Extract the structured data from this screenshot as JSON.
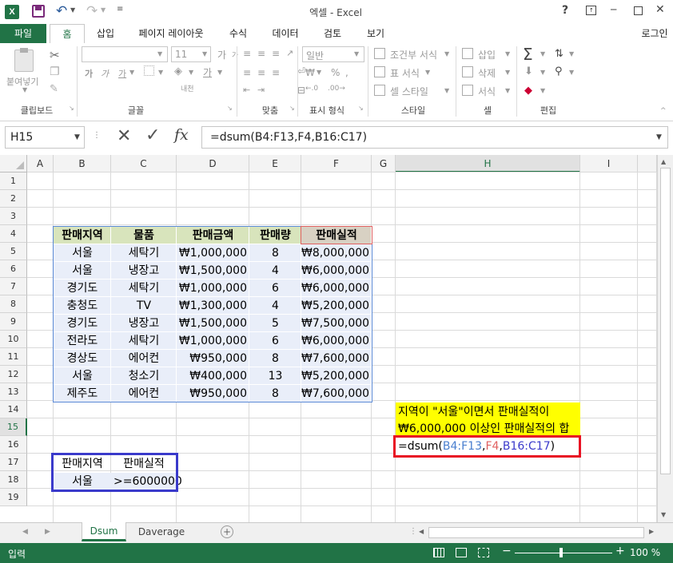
{
  "titlebar": {
    "title": "엑셀 - Excel",
    "help": "?",
    "minimize": "─",
    "close": "✕"
  },
  "menubar": {
    "file": "파일",
    "tabs": [
      "홈",
      "삽입",
      "페이지 레이아웃",
      "수식",
      "데이터",
      "검토",
      "보기"
    ],
    "signin": "로그인"
  },
  "ribbon": {
    "clipboard": {
      "label": "클립보드",
      "paste": "붙여넣기"
    },
    "font": {
      "label": "글꼴",
      "size": "11",
      "bold": "가",
      "italic": "가",
      "underline": "가",
      "grow": "가",
      "shrink": "가"
    },
    "alignment": {
      "label": "맞춤"
    },
    "number": {
      "label": "표시 형식",
      "format": "일반"
    },
    "styles": {
      "label": "스타일",
      "conditional": "조건부 서식",
      "table": "표 서식",
      "cell": "셀 스타일"
    },
    "cells": {
      "label": "셀",
      "insert": "삽입",
      "delete": "삭제",
      "format": "서식"
    },
    "editing": {
      "label": "편집"
    }
  },
  "formulabar": {
    "namebox": "H15",
    "fx": "fx",
    "formula": "=dsum(B4:F13,F4,B16:C17)"
  },
  "columns": [
    "A",
    "B",
    "C",
    "D",
    "E",
    "F",
    "G",
    "H",
    "I"
  ],
  "rows": [
    "1",
    "2",
    "3",
    "4",
    "5",
    "6",
    "7",
    "8",
    "9",
    "10",
    "11",
    "12",
    "13",
    "14",
    "15",
    "16",
    "17",
    "18",
    "19"
  ],
  "table": {
    "headers": [
      "판매지역",
      "물품",
      "판매금액",
      "판매량",
      "판매실적"
    ],
    "rows": [
      [
        "서울",
        "세탁기",
        "₩1,000,000",
        "8",
        "₩8,000,000"
      ],
      [
        "서울",
        "냉장고",
        "₩1,500,000",
        "4",
        "₩6,000,000"
      ],
      [
        "경기도",
        "세탁기",
        "₩1,000,000",
        "6",
        "₩6,000,000"
      ],
      [
        "충청도",
        "TV",
        "₩1,300,000",
        "4",
        "₩5,200,000"
      ],
      [
        "경기도",
        "냉장고",
        "₩1,500,000",
        "5",
        "₩7,500,000"
      ],
      [
        "전라도",
        "세탁기",
        "₩1,000,000",
        "6",
        "₩6,000,000"
      ],
      [
        "경상도",
        "에어컨",
        "₩950,000",
        "8",
        "₩7,600,000"
      ],
      [
        "서울",
        "청소기",
        "₩400,000",
        "13",
        "₩5,200,000"
      ],
      [
        "제주도",
        "에어컨",
        "₩950,000",
        "8",
        "₩7,600,000"
      ]
    ]
  },
  "criteria": {
    "headers": [
      "판매지역",
      "판매실적"
    ],
    "values": [
      "서울",
      ">=6000000"
    ]
  },
  "note": {
    "line1": "지역이 \"서울\"이면서 판매실적이",
    "line2": "₩6,000,000 이상인 판매실적의 합"
  },
  "formula_cell": {
    "prefix": "=dsum(",
    "arg1": "B4:F13",
    "sep1": ",",
    "arg2": "F4",
    "sep2": ",",
    "arg3": "B16:C17",
    "suffix": ")"
  },
  "sheets": {
    "tabs": [
      "Dsum",
      "Daverage"
    ],
    "active": "Dsum"
  },
  "status": {
    "mode": "입력",
    "zoom": "100 %"
  },
  "colors": {
    "excel_green": "#217346",
    "table_header": "#d8e4bc",
    "table_body": "#e9eef9",
    "note_yellow": "#ffff00",
    "red_border": "#e81123",
    "blue_border": "#3a3acb"
  }
}
